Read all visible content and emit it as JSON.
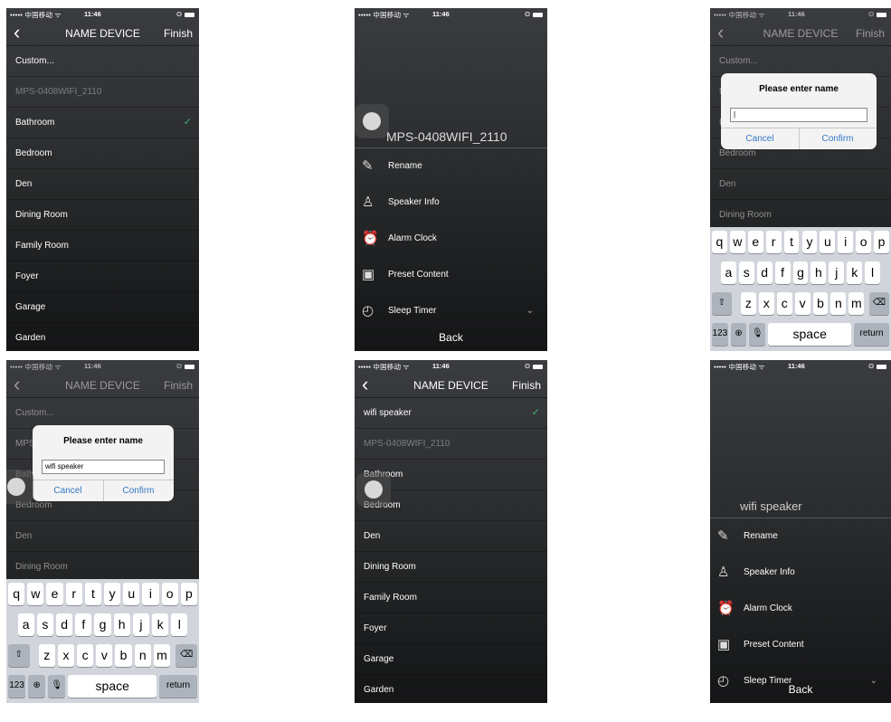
{
  "status": {
    "carrier": "••••• 中国移动 ᯤ",
    "time": "11:46",
    "battery": "ʘ"
  },
  "nav": {
    "back": "‹",
    "title": "NAME DEVICE",
    "finish": "Finish"
  },
  "list_a": [
    "Custom...",
    "MPS-0408WIFI_2110",
    "Bathroom",
    "Bedroom",
    "Den",
    "Dining Room",
    "Family Room",
    "Foyer",
    "Garage",
    "Garden"
  ],
  "list_b": [
    "wifi speaker",
    "MPS-0408WIFI_2110",
    "Bathroom",
    "Bedroom",
    "Den",
    "Dining Room",
    "Family Room",
    "Foyer",
    "Garage",
    "Garden"
  ],
  "checkmark": "✓",
  "device_names": {
    "before": "MPS-0408WIFI_2110",
    "after": "wifi speaker"
  },
  "menu": [
    {
      "icon": "rename-icon",
      "glyph": "✎",
      "label": "Rename"
    },
    {
      "icon": "speaker-info-icon",
      "glyph": "♙",
      "label": "Speaker Info"
    },
    {
      "icon": "alarm-clock-icon",
      "glyph": "⏰",
      "label": "Alarm Clock"
    },
    {
      "icon": "preset-content-icon",
      "glyph": "▣",
      "label": "Preset Content"
    },
    {
      "icon": "sleep-timer-icon",
      "glyph": "◴",
      "label": "Sleep Timer"
    }
  ],
  "menu_chevron": "⌄",
  "menu_back": "Back",
  "dialog": {
    "title": "Please enter name",
    "cancel": "Cancel",
    "confirm": "Confirm",
    "empty_value": "|",
    "typed_value": "wifi speaker"
  },
  "keyboard": {
    "row1": [
      "q",
      "w",
      "e",
      "r",
      "t",
      "y",
      "u",
      "i",
      "o",
      "p"
    ],
    "row2": [
      "a",
      "s",
      "d",
      "f",
      "g",
      "h",
      "j",
      "k",
      "l"
    ],
    "row3": [
      "z",
      "x",
      "c",
      "v",
      "b",
      "n",
      "m"
    ],
    "shift": "⇧",
    "delete": "⌫",
    "numbers": "123",
    "globe": "⊕",
    "mic": "🎙",
    "space": "space",
    "return": "return"
  },
  "colors": {
    "check": "#3cb371",
    "dialog_button": "#3478c6",
    "keyboard_bg": "#d1d5db"
  }
}
